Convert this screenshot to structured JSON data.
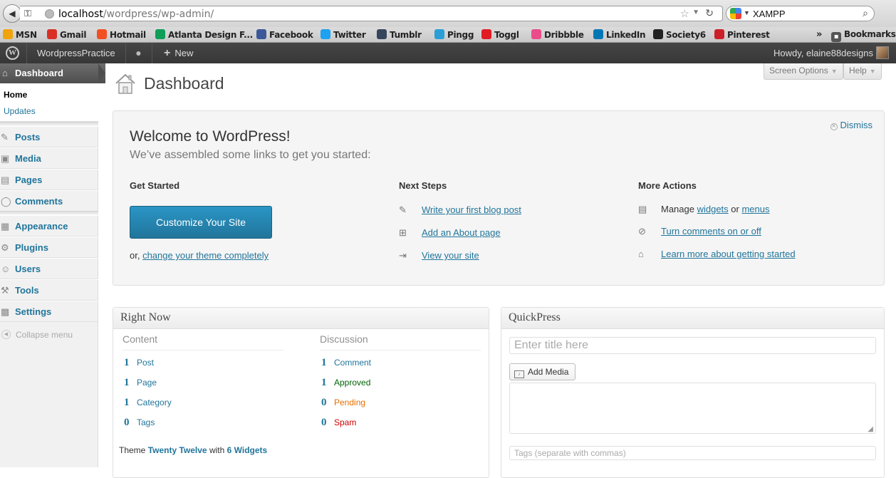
{
  "browser": {
    "address": {
      "host": "localhost",
      "path": "/wordpress/wp-admin/"
    },
    "search": {
      "value": "XAMPP"
    },
    "bookmarks": [
      {
        "label": "MSN",
        "icon": "msn-icon",
        "color": "#f0a30a"
      },
      {
        "label": "Gmail",
        "icon": "gmail-icon",
        "color": "#d93025"
      },
      {
        "label": "Hotmail",
        "icon": "hotmail-icon",
        "color": "#f25022"
      },
      {
        "label": "Atlanta Design F...",
        "icon": "sheets-icon",
        "color": "#0f9d58"
      },
      {
        "label": "Facebook",
        "icon": "facebook-icon",
        "color": "#3b5998"
      },
      {
        "label": "Twitter",
        "icon": "twitter-icon",
        "color": "#1da1f2"
      },
      {
        "label": "Tumblr",
        "icon": "tumblr-icon",
        "color": "#35465c"
      },
      {
        "label": "Pingg",
        "icon": "pingg-icon",
        "color": "#2a9fd6"
      },
      {
        "label": "Toggl",
        "icon": "toggl-icon",
        "color": "#e01b22"
      },
      {
        "label": "Dribbble",
        "icon": "dribbble-icon",
        "color": "#ea4c89"
      },
      {
        "label": "LinkedIn",
        "icon": "linkedin-icon",
        "color": "#0077b5"
      },
      {
        "label": "Society6",
        "icon": "society6-icon",
        "color": "#222222"
      },
      {
        "label": "Pinterest",
        "icon": "pinterest-icon",
        "color": "#cb2027"
      }
    ],
    "overflow": "»",
    "bookmarks_menu": "Bookmarks"
  },
  "adminbar": {
    "site_name": "WordpressPractice",
    "new_label": "New",
    "howdy": "Howdy, elaine88designs"
  },
  "sidebar": {
    "dashboard": "Dashboard",
    "submenu": {
      "home": "Home",
      "updates": "Updates"
    },
    "group1": [
      {
        "label": "Posts",
        "icon": "pin-icon"
      },
      {
        "label": "Media",
        "icon": "media-icon"
      },
      {
        "label": "Pages",
        "icon": "pages-icon"
      },
      {
        "label": "Comments",
        "icon": "comments-icon"
      }
    ],
    "group2": [
      {
        "label": "Appearance",
        "icon": "appearance-icon"
      },
      {
        "label": "Plugins",
        "icon": "plugins-icon"
      },
      {
        "label": "Users",
        "icon": "users-icon"
      },
      {
        "label": "Tools",
        "icon": "tools-icon"
      },
      {
        "label": "Settings",
        "icon": "settings-icon"
      }
    ],
    "collapse": "Collapse menu"
  },
  "header": {
    "title": "Dashboard",
    "screen_options": "Screen Options",
    "help": "Help"
  },
  "welcome": {
    "dismiss": "Dismiss",
    "title": "Welcome to WordPress!",
    "subtitle": "We’ve assembled some links to get you started:",
    "get_started": {
      "heading": "Get Started",
      "button": "Customize Your Site",
      "or": "or, ",
      "change_theme": "change your theme completely"
    },
    "next_steps": {
      "heading": "Next Steps",
      "items": [
        {
          "label": "Write your first blog post",
          "icon": "pin-icon"
        },
        {
          "label": "Add an About page",
          "icon": "add-page-icon"
        },
        {
          "label": "View your site",
          "icon": "view-site-icon"
        }
      ]
    },
    "more_actions": {
      "heading": "More Actions",
      "manage": "Manage ",
      "widgets": "widgets",
      "or": " or ",
      "menus": "menus",
      "comments_toggle": "Turn comments on or off",
      "learn_more": "Learn more about getting started"
    }
  },
  "right_now": {
    "title": "Right Now",
    "content_heading": "Content",
    "discussion_heading": "Discussion",
    "content": [
      {
        "count": "1",
        "label": "Post"
      },
      {
        "count": "1",
        "label": "Page"
      },
      {
        "count": "1",
        "label": "Category"
      },
      {
        "count": "0",
        "label": "Tags"
      }
    ],
    "discussion": [
      {
        "count": "1",
        "label": "Comment",
        "color": "#21759b"
      },
      {
        "count": "1",
        "label": "Approved",
        "color": "#006505"
      },
      {
        "count": "0",
        "label": "Pending",
        "color": "#e66f00"
      },
      {
        "count": "0",
        "label": "Spam",
        "color": "#cc0000"
      }
    ],
    "theme_prefix": "Theme ",
    "theme_name": "Twenty Twelve",
    "theme_with": " with ",
    "widgets": "6 Widgets"
  },
  "quickpress": {
    "title": "QuickPress",
    "title_placeholder": "Enter title here",
    "add_media": "Add Media",
    "tags_placeholder": "Tags (separate with commas)"
  }
}
